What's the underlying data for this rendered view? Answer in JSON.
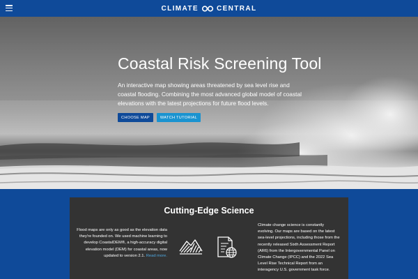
{
  "header": {
    "brand": {
      "text_left": "CLIMATE",
      "text_right": "CENTRAL"
    },
    "menu_icon": "hamburger-menu-icon",
    "logo_icon": "infinity-logo-icon",
    "background_color": "#0f4a99"
  },
  "hero": {
    "title": "Coastal Risk Screening Tool",
    "description": "An interactive map showing areas threatened by sea level rise and coastal flooding. Combining the most advanced global model of coastal elevations with the latest projections for future flood levels.",
    "buttons": [
      {
        "label": "CHOOSE MAP",
        "color": "#0f4a99"
      },
      {
        "label": "WATCH TUTORIAL",
        "color": "#1a93d0"
      }
    ]
  },
  "science": {
    "title": "Cutting-Edge Science",
    "left_text": "Flood maps are only as good as the elevation data they're founded on. We used machine learning to develop CoastalDEM®, a high-accuracy digital elevation model (DEM) for coastal areas, now updated to version 2.1.",
    "read_more": "Read more.",
    "right_text": "Climate change science is constantly evolving. Our maps are based on the latest sea-level projections, including those from the recently released Sixth Assessment Report (AR6) from the Intergovernmental Panel on Climate Change (IPCC) and the 2022 Sea Level Rise Technical Report from an interagency U.S. government task force.",
    "icons": [
      "terrain-elevation-icon",
      "document-globe-icon"
    ],
    "background_color": "#333333",
    "link_color": "#4fa8e0"
  }
}
